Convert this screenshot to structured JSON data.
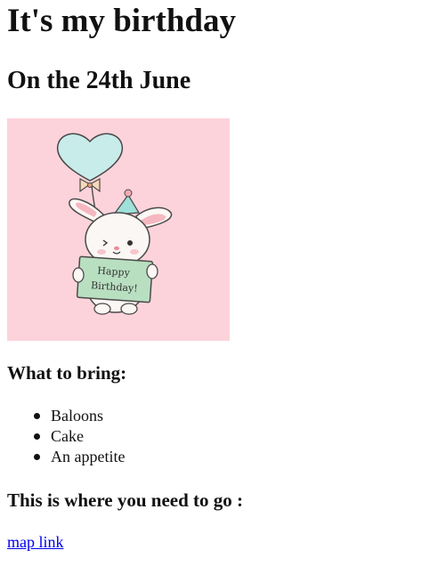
{
  "page": {
    "title": "It's my birthday",
    "date": "On the 24th June"
  },
  "card": {
    "sign_line1": "Happy",
    "sign_line2": "Birthday!",
    "background": "#fdd3db",
    "balloon_color": "#c8ece9",
    "sign_color": "#b9dfc1"
  },
  "bring": {
    "heading": "What to bring:",
    "items": [
      "Baloons",
      "Cake",
      "An appetite"
    ]
  },
  "directions": {
    "heading": "This is where you need to go :",
    "link_label": "map link",
    "link_color": "#0000ee"
  }
}
